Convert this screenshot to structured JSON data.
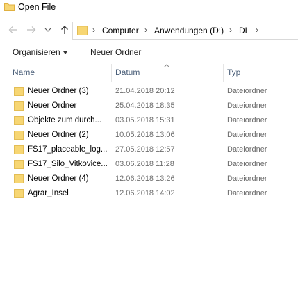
{
  "window": {
    "title": "Open File"
  },
  "address": {
    "crumbs": [
      "Computer",
      "Anwendungen (D:)",
      "DL"
    ]
  },
  "toolbar": {
    "organize_label": "Organisieren",
    "new_folder_label": "Neuer Ordner"
  },
  "columns": {
    "name": "Name",
    "date": "Datum",
    "type": "Typ"
  },
  "files": [
    {
      "name": "Neuer Ordner (3)",
      "date": "21.04.2018 20:12",
      "type": "Dateiordner"
    },
    {
      "name": "Neuer Ordner",
      "date": "25.04.2018 18:35",
      "type": "Dateiordner"
    },
    {
      "name": "Objekte zum durch...",
      "date": "03.05.2018 15:31",
      "type": "Dateiordner"
    },
    {
      "name": "Neuer Ordner (2)",
      "date": "10.05.2018 13:06",
      "type": "Dateiordner"
    },
    {
      "name": "FS17_placeable_log...",
      "date": "27.05.2018 12:57",
      "type": "Dateiordner"
    },
    {
      "name": "FS17_Silo_Vitkovice...",
      "date": "03.06.2018 11:28",
      "type": "Dateiordner"
    },
    {
      "name": "Neuer Ordner (4)",
      "date": "12.06.2018 13:26",
      "type": "Dateiordner"
    },
    {
      "name": "Agrar_Insel",
      "date": "12.06.2018 14:02",
      "type": "Dateiordner"
    }
  ],
  "colors": {
    "folder": "#f7d673",
    "folder_dark": "#e8b942",
    "header_text": "#4c607a",
    "muted_text": "#6d6d6d"
  },
  "icons": {
    "app": "folder-icon",
    "back": "arrow-left-icon",
    "forward": "arrow-right-icon",
    "dropdown": "chevron-down-icon",
    "up": "arrow-up-icon",
    "sort": "sort-ascending-icon"
  }
}
